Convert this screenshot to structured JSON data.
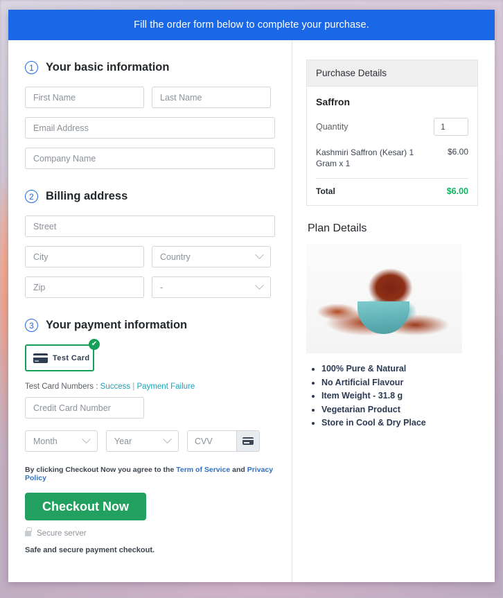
{
  "banner": {
    "text": "Fill the order form below to complete your purchase."
  },
  "sections": {
    "basic": {
      "number": "1",
      "title": "Your basic information",
      "fields": {
        "first_name": "First Name",
        "last_name": "Last Name",
        "email": "Email Address",
        "company": "Company Name"
      }
    },
    "billing": {
      "number": "2",
      "title": "Billing address",
      "fields": {
        "street": "Street",
        "city": "City",
        "country": "Country",
        "zip": "Zip",
        "state": "-"
      }
    },
    "payment": {
      "number": "3",
      "title": "Your payment information",
      "method": {
        "label": "Test Card",
        "icon": "credit-card-icon",
        "selected_badge": "✔"
      },
      "test_cards": {
        "prefix": "Test Card Numbers : ",
        "success": "Success",
        "separator": " | ",
        "failure": "Payment Failure"
      },
      "fields": {
        "card_number": "Credit Card Number",
        "month": "Month",
        "year": "Year",
        "cvv": "CVV"
      },
      "terms": {
        "before": "By clicking Checkout Now you agree to the ",
        "tos": "Term of Service",
        "middle": " and ",
        "privacy": "Privacy Policy"
      },
      "checkout_label": "Checkout Now",
      "secure_label": "Secure server",
      "safe_label": "Safe and secure payment checkout."
    }
  },
  "purchase_details": {
    "heading": "Purchase Details",
    "product": "Saffron",
    "quantity_label": "Quantity",
    "quantity_value": "1",
    "line_item": {
      "name": "Kashmiri Saffron (Kesar) 1 Gram x 1",
      "amount": "$6.00"
    },
    "total_label": "Total",
    "total_amount": "$6.00"
  },
  "plan_details": {
    "heading": "Plan Details",
    "image_alt": "saffron-threads-in-bowl",
    "bullets": [
      "100% Pure & Natural",
      "No Artificial Flavour",
      "Item Weight - 31.8 g",
      "Vegetarian Product",
      "Store in Cool & Dry Place"
    ]
  },
  "colors": {
    "banner_blue": "#1a68e5",
    "accent_green": "#21a05f",
    "total_green": "#13b362",
    "link_teal": "#17a2b8",
    "link_blue": "#2f6fc4"
  }
}
